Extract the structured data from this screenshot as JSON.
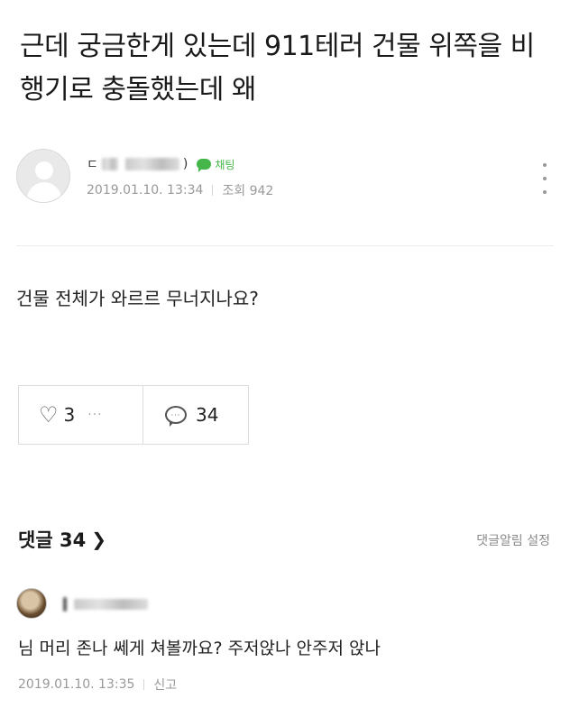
{
  "post": {
    "title": "근데 궁금한게 있는데 911테러 건물 위쪽을 비행기로 충돌했는데 왜",
    "author": {
      "nickname_start": "ㄷ",
      "nickname_end": ")",
      "chat_label": "채팅",
      "date": "2019.01.10. 13:34",
      "views": "조회 942"
    },
    "body": "건물 전체가 와르르 무너지나요?",
    "likes": "3",
    "more_dots": "···",
    "comment_count": "34"
  },
  "comments_section": {
    "header": "댓글 34",
    "notify_setting": "댓글알림 설정",
    "items": [
      {
        "text": "님 머리 존나 쎄게 쳐볼까요? 주저앉나 안주저 앉나",
        "date": "2019.01.10. 13:35",
        "report": "신고"
      }
    ]
  },
  "colors": {
    "accent_green": "#45b74a",
    "meta_gray": "#999999"
  }
}
